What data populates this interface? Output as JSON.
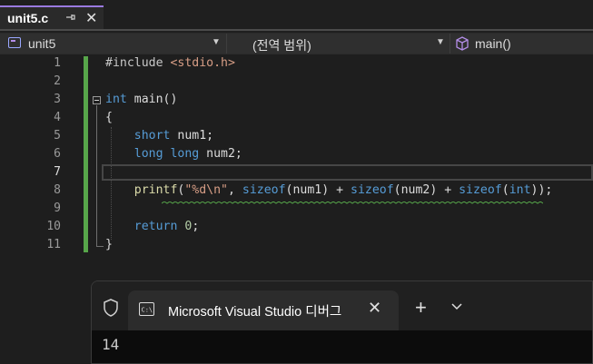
{
  "tab": {
    "title": "unit5.c",
    "pin": "⊣",
    "close": "✕"
  },
  "navbar": {
    "project": "unit5",
    "scope": "(전역 범위)",
    "member": "main()",
    "arrow": "▼"
  },
  "lines": [
    "1",
    "2",
    "3",
    "4",
    "5",
    "6",
    "7",
    "8",
    "9",
    "10",
    "11"
  ],
  "code": {
    "l1a": "#include ",
    "l1b": "<stdio.h>",
    "l3a": "int",
    "l3b": " main()",
    "l4": "{",
    "l5a": "    short",
    "l5b": " num1;",
    "l6a": "    long long",
    "l6b": " num2;",
    "l8a": "    ",
    "l8b": "printf",
    "l8c": "(",
    "l8d": "\"%d\\n\"",
    "l8e": ", ",
    "l8f": "sizeof",
    "l8g": "(num1) + ",
    "l8h": "sizeof",
    "l8i": "(num2) + ",
    "l8j": "sizeof",
    "l8k": "(",
    "l8l": "int",
    "l8m": "));",
    "l10a": "    return",
    "l10b": " ",
    "l10c": "0",
    "l10d": ";",
    "l11": "}"
  },
  "terminal": {
    "tab_title": "Microsoft Visual Studio 디버그",
    "close": "✕",
    "plus": "+",
    "chevron": "⌄",
    "output": "14"
  },
  "colors": {
    "change_bar": "#57a64a",
    "keyword": "#569cd6",
    "string": "#d69d85",
    "function": "#dcdcaa",
    "tab_accent": "#9a7ae0"
  }
}
